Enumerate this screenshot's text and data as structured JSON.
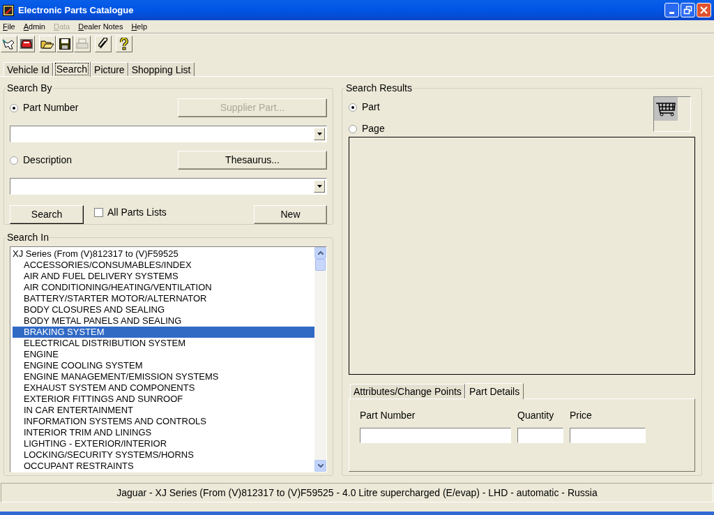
{
  "window": {
    "title": "Electronic Parts Catalogue",
    "controls": [
      {
        "kind": "minimize"
      },
      {
        "kind": "restore"
      },
      {
        "kind": "close"
      }
    ]
  },
  "menu": [
    {
      "label": "File",
      "disabled": false
    },
    {
      "label": "Admin",
      "disabled": false
    },
    {
      "label": "Data",
      "disabled": true
    },
    {
      "label": "Dealer Notes",
      "disabled": false
    },
    {
      "label": "Help",
      "disabled": false
    }
  ],
  "toolbar": [
    {
      "buttons": [
        {
          "kind": "vehicle",
          "disabled": false
        },
        {
          "kind": "car",
          "disabled": false
        }
      ]
    },
    {
      "buttons": [
        {
          "kind": "open",
          "disabled": false
        },
        {
          "kind": "save",
          "disabled": false
        },
        {
          "kind": "print",
          "disabled": true
        }
      ]
    },
    {
      "buttons": [
        {
          "kind": "clip",
          "disabled": false
        }
      ]
    },
    {
      "buttons": [
        {
          "kind": "help",
          "disabled": false
        }
      ]
    }
  ],
  "tabs": [
    {
      "label": "Vehicle Id",
      "selected": false
    },
    {
      "label": "Search",
      "selected": true
    },
    {
      "label": "Picture",
      "selected": false
    },
    {
      "label": "Shopping List",
      "selected": false
    }
  ],
  "search_by": {
    "title": "Search By",
    "options": [
      {
        "label": "Part Number",
        "selected": true,
        "button": {
          "label": "Supplier Part...",
          "disabled": true
        }
      },
      {
        "label": "Description",
        "selected": false,
        "button": {
          "label": "Thesaurus...",
          "disabled": false
        }
      }
    ],
    "search_button": "Search",
    "all_parts_lists": {
      "label": "All Parts Lists",
      "checked": false
    },
    "new_button": "New"
  },
  "search_in": {
    "title": "Search In",
    "tree": [
      {
        "label": "XJ Series (From (V)812317 to (V)F59525",
        "selected": false,
        "children": [
          {
            "label": "ACCESSORIES/CONSUMABLES/INDEX",
            "selected": false
          },
          {
            "label": "AIR AND FUEL DELIVERY SYSTEMS",
            "selected": false
          },
          {
            "label": "AIR CONDITIONING/HEATING/VENTILATION",
            "selected": false
          },
          {
            "label": "BATTERY/STARTER MOTOR/ALTERNATOR",
            "selected": false
          },
          {
            "label": "BODY CLOSURES AND SEALING",
            "selected": false
          },
          {
            "label": "BODY METAL PANELS AND SEALING",
            "selected": false
          },
          {
            "label": "BRAKING SYSTEM",
            "selected": true
          },
          {
            "label": "ELECTRICAL DISTRIBUTION SYSTEM",
            "selected": false
          },
          {
            "label": "ENGINE",
            "selected": false
          },
          {
            "label": "ENGINE COOLING SYSTEM",
            "selected": false
          },
          {
            "label": "ENGINE MANAGEMENT/EMISSION SYSTEMS",
            "selected": false
          },
          {
            "label": "EXHAUST SYSTEM AND COMPONENTS",
            "selected": false
          },
          {
            "label": "EXTERIOR FITTINGS AND SUNROOF",
            "selected": false
          },
          {
            "label": "IN CAR ENTERTAINMENT",
            "selected": false
          },
          {
            "label": "INFORMATION SYSTEMS AND CONTROLS",
            "selected": false
          },
          {
            "label": "INTERIOR TRIM AND LININGS",
            "selected": false
          },
          {
            "label": "LIGHTING - EXTERIOR/INTERIOR",
            "selected": false
          },
          {
            "label": "LOCKING/SECURITY SYSTEMS/HORNS",
            "selected": false
          },
          {
            "label": "OCCUPANT RESTRAINTS",
            "selected": false
          }
        ]
      }
    ]
  },
  "search_results": {
    "title": "Search Results",
    "options": [
      {
        "label": "Part",
        "selected": true
      },
      {
        "label": "Page",
        "selected": false
      }
    ],
    "tabs": [
      {
        "label": "Attributes/Change Points",
        "selected": false
      },
      {
        "label": "Part Details",
        "selected": true
      }
    ],
    "fields": [
      {
        "label": "Part Number"
      },
      {
        "label": "Quantity"
      },
      {
        "label": "Price"
      }
    ]
  },
  "status_bar": "Jaguar - XJ Series (From (V)812317 to (V)F59525 - 4.0 Litre supercharged (E/evap) - LHD - automatic - Russia"
}
